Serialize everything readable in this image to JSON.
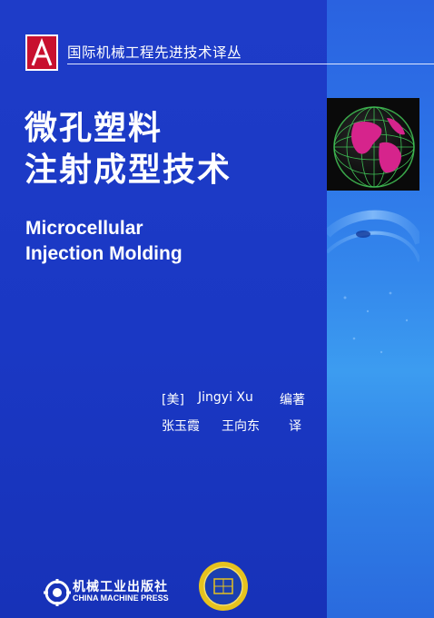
{
  "series": {
    "title": "国际机械工程先进技术译丛"
  },
  "title": {
    "cn_line1": "微孔塑料",
    "cn_line2": "注射成型技术",
    "en_line1": "Microcellular",
    "en_line2": "Injection Molding"
  },
  "authors": {
    "country": "[美]",
    "author": "Jingyi Xu",
    "author_role": "编著",
    "translator1": "张玉霞",
    "translator2": "王向东",
    "translator_role": "译"
  },
  "publisher": {
    "cn": "机械工业出版社",
    "en": "CHINA MACHINE PRESS"
  },
  "colors": {
    "background": "#1e3cc8",
    "strip": "#3488ec",
    "text": "#ffffff",
    "logo_red": "#c8102e",
    "medal_gold": "#e6c21e"
  },
  "icons": {
    "series_logo": "stylized-A-logo-icon",
    "publisher_logo": "gear-publisher-logo-icon",
    "medal": "award-medal-icon",
    "globe": "globe-icon"
  }
}
